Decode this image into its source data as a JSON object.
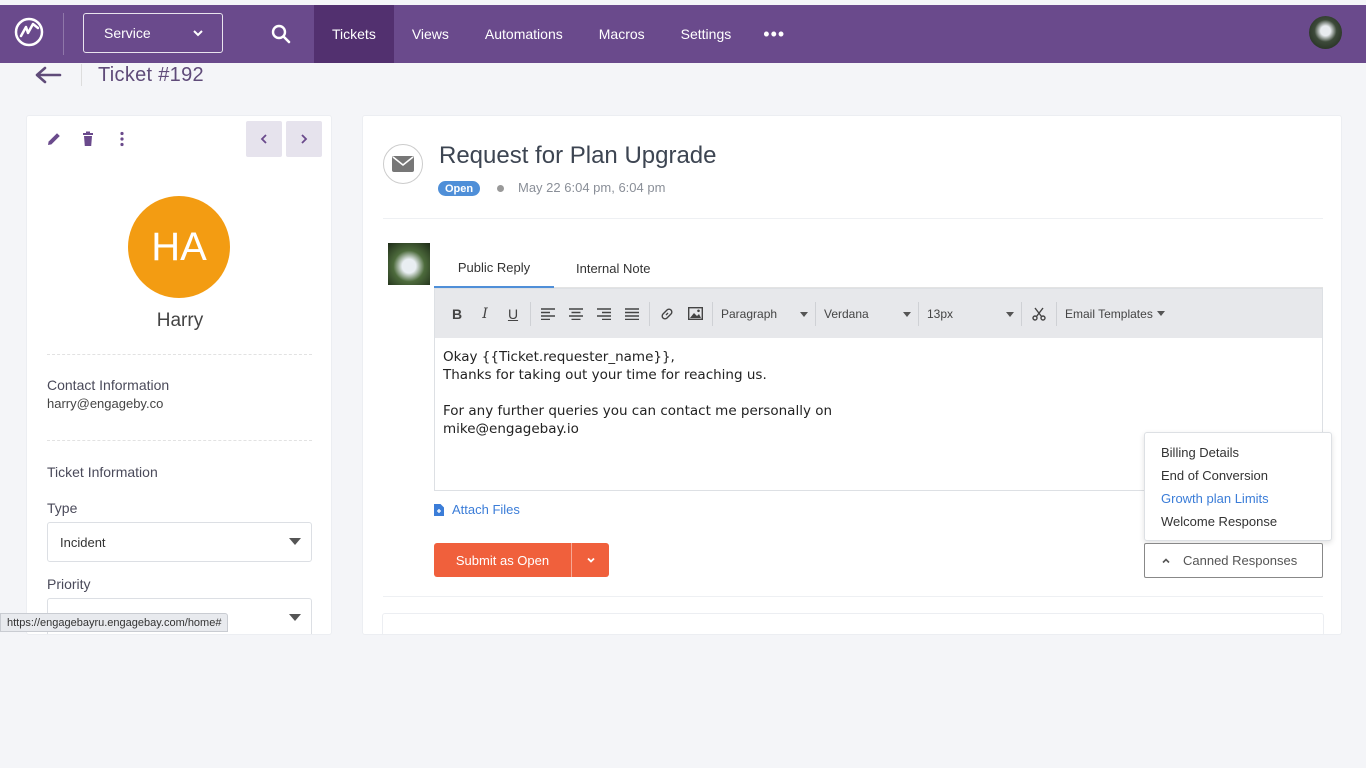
{
  "nav": {
    "module_select": "Service",
    "tabs": [
      {
        "label": "Tickets",
        "active": true
      },
      {
        "label": "Views",
        "active": false
      },
      {
        "label": "Automations",
        "active": false
      },
      {
        "label": "Macros",
        "active": false
      },
      {
        "label": "Settings",
        "active": false
      }
    ],
    "more": "•••",
    "brand_color": "#6a4a8c",
    "active_tab_color": "#52306f"
  },
  "header": {
    "title": "Ticket #192"
  },
  "contact": {
    "initials": "HA",
    "name": "Harry",
    "avatar_color": "#f39c12",
    "contact_info_heading": "Contact Information",
    "email": "harry@engageby.co",
    "ticket_info_heading": "Ticket Information",
    "type_label": "Type",
    "type_value": "Incident",
    "priority_label": "Priority",
    "priority_value": ""
  },
  "status_bar": {
    "url": "https://engagebayru.engagebay.com/home#"
  },
  "ticket": {
    "subject": "Request for Plan Upgrade",
    "status": "Open",
    "date": "May 22 6:04 pm, 6:04 pm"
  },
  "reply": {
    "tabs": [
      {
        "label": "Public Reply",
        "active": true
      },
      {
        "label": "Internal Note",
        "active": false
      }
    ],
    "toolbar": {
      "bold": "B",
      "italic": "I",
      "underline": "U",
      "paragraph": "Paragraph",
      "font": "Verdana",
      "size": "13px",
      "templates": "Email Templates"
    },
    "body_lines": [
      "Okay {{Ticket.requester_name}},",
      "Thanks for taking out your time for reaching us.",
      "",
      "For any further queries you can contact me personally on",
      "mike@engagebay.io"
    ],
    "attach_label": "Attach Files",
    "submit_label": "Submit as Open"
  },
  "canned": {
    "button_label": "Canned Responses",
    "items": [
      "Billing Details",
      "End of Conversion",
      "Growth plan Limits",
      "Welcome Response"
    ]
  },
  "bottom_card": {
    "text": ""
  }
}
